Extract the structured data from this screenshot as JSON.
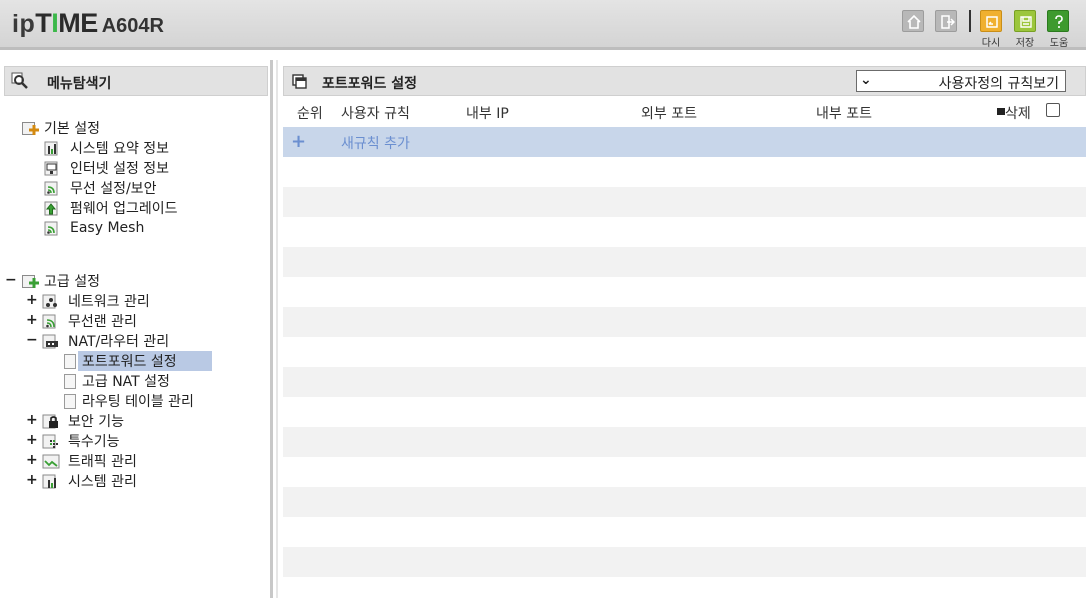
{
  "header": {
    "logo_ip": "ip",
    "logo_time_t": "T",
    "logo_time_i": "I",
    "logo_time_me": "ME",
    "model": "A604R",
    "buttons": {
      "home": "home-icon",
      "logout": "logout-icon",
      "restart_label": "다시",
      "save_label": "저장",
      "help_label": "도움"
    },
    "colors": {
      "restart": "#f0b030",
      "save": "#9cc63c",
      "help": "#3e9a2e"
    }
  },
  "sidebar": {
    "title": "메뉴탐색기",
    "basic": {
      "label": "기본 설정",
      "items": [
        "시스템 요약 정보",
        "인터넷 설정 정보",
        "무선 설정/보안",
        "펌웨어 업그레이드",
        "Easy Mesh"
      ]
    },
    "advanced": {
      "label": "고급 설정",
      "items": [
        {
          "toggle": "+",
          "label": "네트워크 관리"
        },
        {
          "toggle": "+",
          "label": "무선랜 관리"
        },
        {
          "toggle": "−",
          "label": "NAT/라우터 관리"
        },
        {
          "toggle": "+",
          "label": "보안 기능"
        },
        {
          "toggle": "+",
          "label": "특수기능"
        },
        {
          "toggle": "+",
          "label": "트래픽 관리"
        },
        {
          "toggle": "+",
          "label": "시스템 관리"
        }
      ],
      "toggle": "−",
      "nat_children": [
        "포트포워드 설정",
        "고급 NAT 설정",
        "라우팅 테이블 관리"
      ],
      "selected": "포트포워드 설정"
    }
  },
  "main": {
    "title": "포트포워드 설정",
    "view_select": "사용자정의 규칙보기",
    "columns": [
      "순위",
      "사용자 규칙",
      "내부 IP",
      "외부 포트",
      "내부 포트",
      "삭제"
    ],
    "add_rule": "새규칙 추가",
    "add_icon": "+"
  }
}
